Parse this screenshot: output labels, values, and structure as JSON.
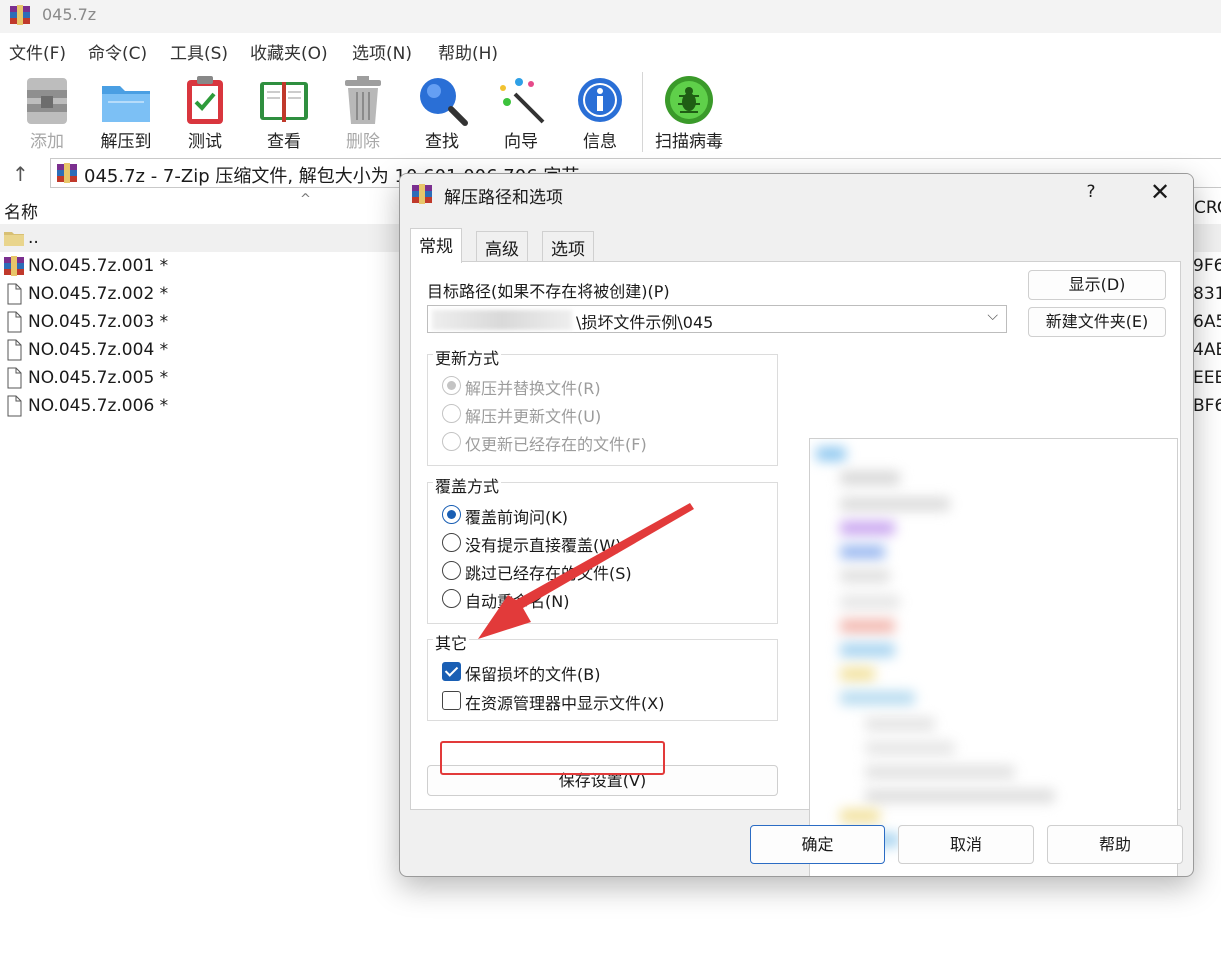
{
  "window": {
    "title": "045.7z",
    "menu": [
      "文件(F)",
      "命令(C)",
      "工具(S)",
      "收藏夹(O)",
      "选项(N)",
      "帮助(H)"
    ],
    "toolbar": [
      {
        "label": "添加",
        "icon": "add-archive-icon",
        "enabled": false
      },
      {
        "label": "解压到",
        "icon": "extract-folder-icon",
        "enabled": true
      },
      {
        "label": "测试",
        "icon": "test-clipboard-icon",
        "enabled": true
      },
      {
        "label": "查看",
        "icon": "view-book-icon",
        "enabled": true
      },
      {
        "label": "删除",
        "icon": "delete-trash-icon",
        "enabled": false
      },
      {
        "label": "查找",
        "icon": "find-magnifier-icon",
        "enabled": true
      },
      {
        "label": "向导",
        "icon": "wizard-wand-icon",
        "enabled": true
      },
      {
        "label": "信息",
        "icon": "info-icon",
        "enabled": true
      },
      {
        "label": "扫描病毒",
        "icon": "virus-scan-icon",
        "enabled": true
      }
    ],
    "address": "045.7z - 7-Zip 压缩文件, 解包大小为 10,601,006,706 字节",
    "columns": {
      "name": "名称",
      "crc": "CRC"
    },
    "files": [
      {
        "name": "..",
        "crc": "",
        "icon": "folder-icon"
      },
      {
        "name": "NO.045.7z.001 *",
        "crc": "9F6",
        "icon": "archive-icon"
      },
      {
        "name": "NO.045.7z.002 *",
        "crc": "831",
        "icon": "file-icon"
      },
      {
        "name": "NO.045.7z.003 *",
        "crc": "6A5",
        "icon": "file-icon"
      },
      {
        "name": "NO.045.7z.004 *",
        "crc": "4AE",
        "icon": "file-icon"
      },
      {
        "name": "NO.045.7z.005 *",
        "crc": "EEE",
        "icon": "file-icon"
      },
      {
        "name": "NO.045.7z.006 *",
        "crc": "BF6",
        "icon": "file-icon"
      }
    ]
  },
  "dialog": {
    "title": "解压路径和选项",
    "help_label": "?",
    "close_label": "✕",
    "tabs": [
      "常规",
      "高级",
      "选项"
    ],
    "active_tab": "常规",
    "dest_label": "目标路径(如果不存在将被创建)(P)",
    "dest_value": "\\损坏文件示例\\045",
    "show_button": "显示(D)",
    "new_folder_button": "新建文件夹(E)",
    "update_group": {
      "title": "更新方式",
      "options": [
        "解压并替换文件(R)",
        "解压并更新文件(U)",
        "仅更新已经存在的文件(F)"
      ],
      "selected": 0,
      "disabled": true
    },
    "overwrite_group": {
      "title": "覆盖方式",
      "options": [
        "覆盖前询问(K)",
        "没有提示直接覆盖(W)",
        "跳过已经存在的文件(S)",
        "自动重命名(N)"
      ],
      "selected": 0
    },
    "misc_group": {
      "title": "其它",
      "options": [
        {
          "label": "保留损坏的文件(B)",
          "checked": true
        },
        {
          "label": "在资源管理器中显示文件(X)",
          "checked": false
        }
      ]
    },
    "save_settings_button": "保存设置(V)",
    "ok_button": "确定",
    "cancel_button": "取消",
    "help_button": "帮助",
    "annotation_color": "#e23a3a"
  }
}
